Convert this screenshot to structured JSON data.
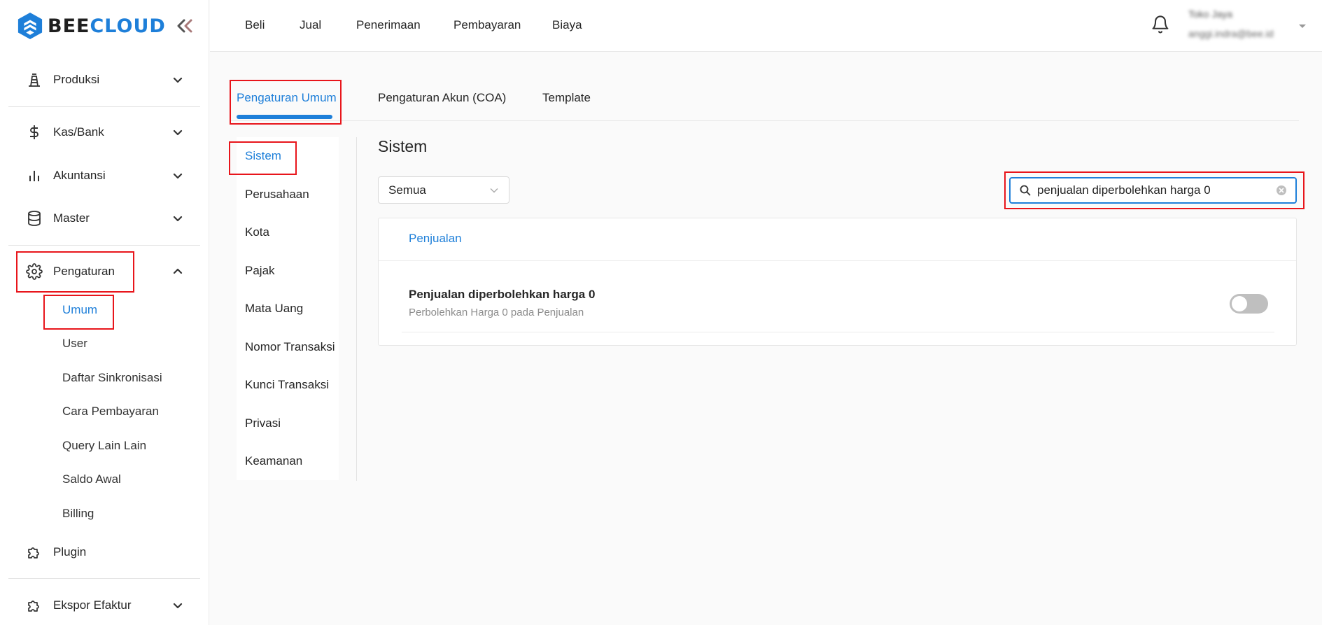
{
  "app": {
    "logo_bee": "BEE",
    "logo_cloud": "CLOUD",
    "brand_color": "#1e7fd9"
  },
  "topnav": {
    "items": [
      "Beli",
      "Jual",
      "Penerimaan",
      "Pembayaran",
      "Biaya"
    ],
    "user_name": "Toko Jaya",
    "user_email": "anggi.indra@bee.id"
  },
  "sidebar": {
    "items": [
      {
        "label": "Produksi",
        "icon": "production-icon"
      },
      {
        "label": "Kas/Bank",
        "icon": "dollar-icon"
      },
      {
        "label": "Akuntansi",
        "icon": "bar-chart-icon"
      },
      {
        "label": "Master",
        "icon": "database-icon"
      },
      {
        "label": "Pengaturan",
        "icon": "gear-icon"
      },
      {
        "label": "Plugin",
        "icon": "puzzle-icon"
      },
      {
        "label": "Ekspor Efaktur",
        "icon": "puzzle-icon"
      }
    ],
    "pengaturan_sub": [
      "Umum",
      "User",
      "Daftar Sinkronisasi",
      "Cara Pembayaran",
      "Query Lain Lain",
      "Saldo Awal",
      "Billing"
    ]
  },
  "tabs": [
    "Pengaturan Umum",
    "Pengaturan Akun (COA)",
    "Template"
  ],
  "settings_menu": [
    "Sistem",
    "Perusahaan",
    "Kota",
    "Pajak",
    "Mata Uang",
    "Nomor Transaksi",
    "Kunci Transaksi",
    "Privasi",
    "Keamanan"
  ],
  "content": {
    "title": "Sistem",
    "filter_value": "Semua",
    "search_value": "penjualan diperbolehkan harga 0",
    "group_label": "Penjualan",
    "setting": {
      "title": "Penjualan diperbolehkan harga 0",
      "description": "Perbolehkan Harga 0 pada Penjualan",
      "enabled": false
    }
  }
}
